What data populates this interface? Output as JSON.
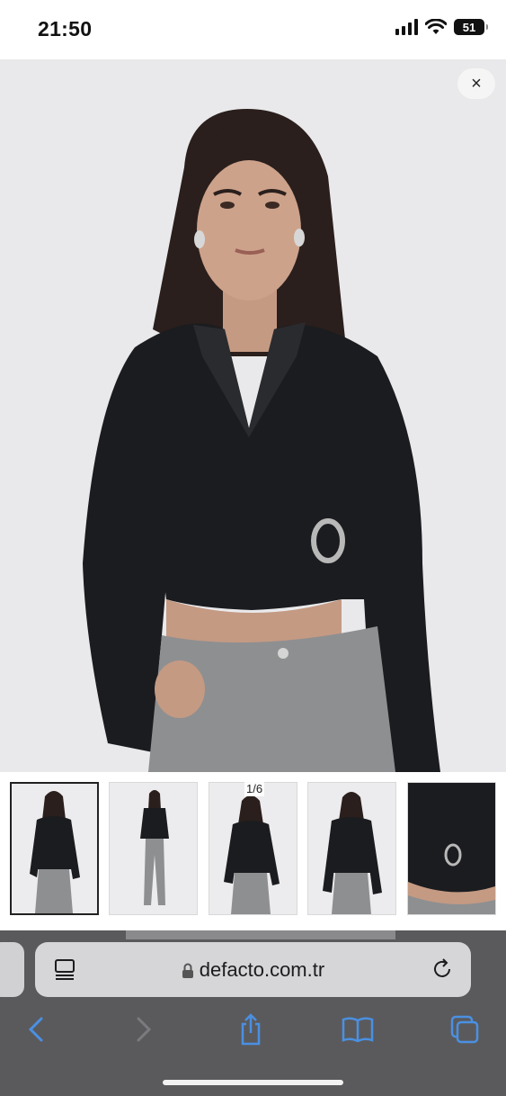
{
  "status_bar": {
    "time": "21:50",
    "battery": "51"
  },
  "hero": {
    "close_label": "×"
  },
  "gallery": {
    "counter": "1/6",
    "thumbnail_count": 5,
    "active_index": 0
  },
  "browser": {
    "url": "defacto.com.tr",
    "accent": "#4a90e2"
  },
  "colors": {
    "background": "#e9e9eb",
    "top_black": "#1b1c1f",
    "jeans": "#8e8f91",
    "skin": "#c79d86",
    "hair": "#2a1f1c",
    "toolbar": "#5a5a5d"
  }
}
